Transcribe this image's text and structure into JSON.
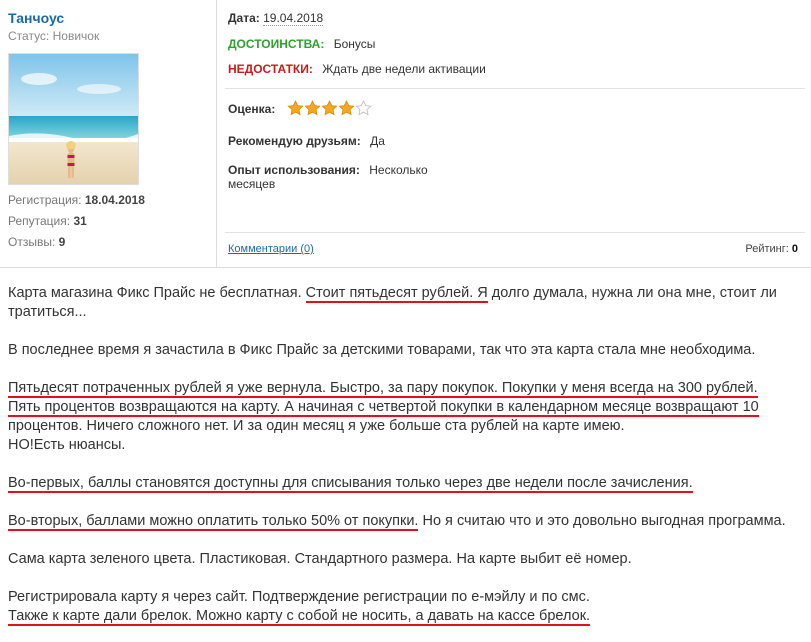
{
  "user": {
    "name": "Танчоус",
    "status": "Статус: Новичок",
    "registration_label": "Регистрация:",
    "registration_value": "18.04.2018",
    "reputation_label": "Репутация:",
    "reputation_value": "31",
    "reviews_label": "Отзывы:",
    "reviews_value": "9"
  },
  "review_meta": {
    "date_label": "Дата:",
    "date_value": "19.04.2018",
    "pros_label": "ДОСТОИНСТВА:",
    "pros_value": "Бонусы",
    "cons_label": "НЕДОСТАТКИ:",
    "cons_value": "Ждать две недели активации",
    "score_label": "Оценка:",
    "score_value": 4,
    "score_max": 5,
    "recommend_label": "Рекомендую друзьям:",
    "recommend_value": "Да",
    "experience_label": "Опыт использования:",
    "experience_value_1": "Несколько",
    "experience_value_2": "месяцев",
    "comments_link": "Комментарии (0)",
    "rating_label": "Рейтинг:",
    "rating_value": "0"
  },
  "colors": {
    "link": "#1a6aa6",
    "pros": "#2ea12e",
    "cons": "#cc1a1a",
    "star": "#f5a623",
    "underline": "#e0101c"
  },
  "review": {
    "p1_a": "Карта магазина Фикс Прайс не бесплатная. ",
    "p1_u": "Стоит пятьдесят рублей. Я",
    "p1_b": " долго думала, нужна ли она мне, стоит ли тратиться...",
    "p2": "В последнее время я зачастила в Фикс Прайс за детскими товарами, так что эта карта стала мне необходима.",
    "p3_u1": "Пятьдесят потраченных рублей я уже вернула. Быстро, за пару покупок. Покупки у меня всегда на 300 рублей.",
    "p3_u2": "Пять процентов возвращаются на карту. А начиная с четвертой покупки в календарном месяце возвращают 10",
    "p3_c": "процентов. Ничего сложного нет. И за один месяц я уже больше ста рублей на карте имею.",
    "p3_d": "НО!Есть нюансы.",
    "p4_u": "Во-первых, баллы становятся доступны для списывания только через две недели после зачисления.",
    "p5_u": "Во-вторых, баллами можно оплатить только 50% от покупки.",
    "p5_b": " Но я считаю что и это довольно выгодная программа.",
    "p6": "Сама карта зеленого цвета. Пластиковая. Стандартного размера. На карте выбит её номер.",
    "p7_a": "Регистрировала карту я через сайт. Подтверждение регистрации по е-мэйлу и по смс.",
    "p7_u": "Также к карте дали брелок. Можно карту с собой не носить, а давать на кассе брелок."
  }
}
